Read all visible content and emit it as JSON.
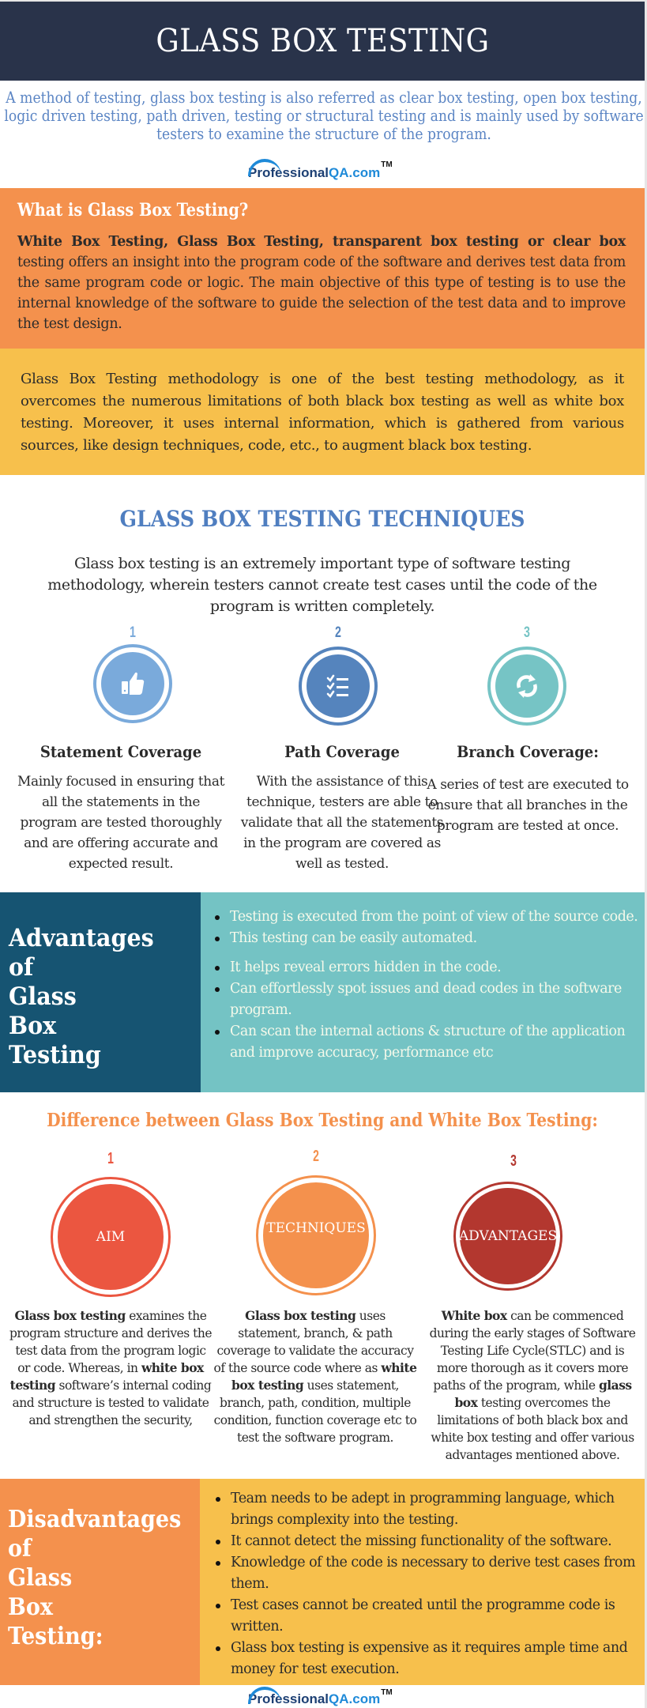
{
  "header": {
    "title": "GLASS BOX TESTING"
  },
  "intro": "A method of testing, glass box testing is also referred as clear box testing, open box testing, logic driven testing, path driven, testing or structural testing and is mainly used by software testers to examine the structure of the program.",
  "logo": {
    "part1": "Professional",
    "part2": "QA.com",
    "tm": "TM"
  },
  "what_is": {
    "heading": "What is Glass Box Testing?",
    "bold_lead": "White Box Testing, Glass Box Testing, transparent box testing or clear box",
    "body": " testing offers an insight into the program code of the software and derives test data from the same program code or logic. The main objective of this type of testing is to use the internal knowledge of the software to guide the selection of the test data and to improve the test design."
  },
  "methodology": "Glass Box Testing methodology is one of the best testing methodology, as it overcomes the numerous limitations of both black box testing as well as white box testing. Moreover, it uses internal information, which is gathered from various sources, like design techniques, code, etc., to augment black box testing.",
  "techniques": {
    "title": "GLASS BOX TESTING TECHNIQUES",
    "intro": "Glass box testing is an extremely important type of software testing methodology, wherein testers cannot create test cases until the code of the program is written completely.",
    "items": [
      {
        "number": "1",
        "icon": "thumbs-up-icon",
        "color": "#7aaadb",
        "title": "Statement Coverage",
        "text": "Mainly focused in ensuring that all the statements in the program are tested thoroughly and are offering accurate and expected result."
      },
      {
        "number": "2",
        "icon": "checklist-icon",
        "color": "#5584bd",
        "title": "Path Coverage",
        "text": "With the assistance of this technique, testers are able to validate that all the statements in the program are covered as well as tested."
      },
      {
        "number": "3",
        "icon": "refresh-icon",
        "color": "#76c4c5",
        "title": "Branch Coverage:",
        "text": "A series of test are executed to ensure that all branches in the program are tested at once."
      }
    ]
  },
  "advantages": {
    "title_lines": [
      "Advantages",
      "of",
      "Glass",
      "Box",
      "Testing"
    ],
    "items": [
      "Testing is executed from the point of view of the source code.",
      "This testing can be easily automated.",
      "It helps reveal errors hidden in the code.",
      "Can effortlessly spot issues and dead codes in the software program.",
      "Can scan the internal actions & structure of the application and improve accuracy, performance etc"
    ]
  },
  "difference": {
    "title": "Difference between Glass Box Testing and White Box Testing:",
    "items": [
      {
        "number": "1",
        "label": "AIM",
        "color": "#eb5640",
        "segments": [
          {
            "b": "Glass box testing"
          },
          {
            "t": " examines the program structure and derives the test data from the program logic or code. Whereas, in "
          },
          {
            "b": "white box testing"
          },
          {
            "t": " software’s internal coding and structure is tested to validate and strengthen the security,"
          }
        ]
      },
      {
        "number": "2",
        "label": "TECHNIQUES",
        "color": "#f4914d",
        "segments": [
          {
            "b": "Glass box testing"
          },
          {
            "t": " uses statement, branch, & path coverage to validate the accuracy of the source code where as "
          },
          {
            "b": "white box testing"
          },
          {
            "t": " uses statement, branch, path, condition, multiple condition, function coverage etc to test the software program."
          }
        ]
      },
      {
        "number": "3",
        "label": "ADVANTAGES",
        "color": "#b3372f",
        "segments": [
          {
            "b": "White box"
          },
          {
            "t": " can be commenced during the early stages of Software Testing Life Cycle(STLC) and is more thorough as it covers more paths of the program, while "
          },
          {
            "b": "glass box"
          },
          {
            "t": " testing overcomes the limitations of both black box and white box testing and offer various advantages mentioned above."
          }
        ]
      }
    ]
  },
  "disadvantages": {
    "title_lines": [
      "Disadvantages",
      "of",
      "Glass",
      "Box",
      "Testing:"
    ],
    "items": [
      "Team needs to be adept in programming language, which brings complexity into the testing.",
      "It cannot detect the missing functionality of the software.",
      "Knowledge of the code is necessary to derive test cases from them.",
      "Test cases cannot be created until the programme code is written.",
      "Glass box testing is expensive as it requires ample time and money for test execution."
    ]
  },
  "colors": {
    "header_bg": "#29334a",
    "orange": "#f4914d",
    "yellow": "#f7c04c",
    "teal": "#74c3c4",
    "dark_teal": "#165472",
    "blue_title": "#4f7ec0"
  }
}
